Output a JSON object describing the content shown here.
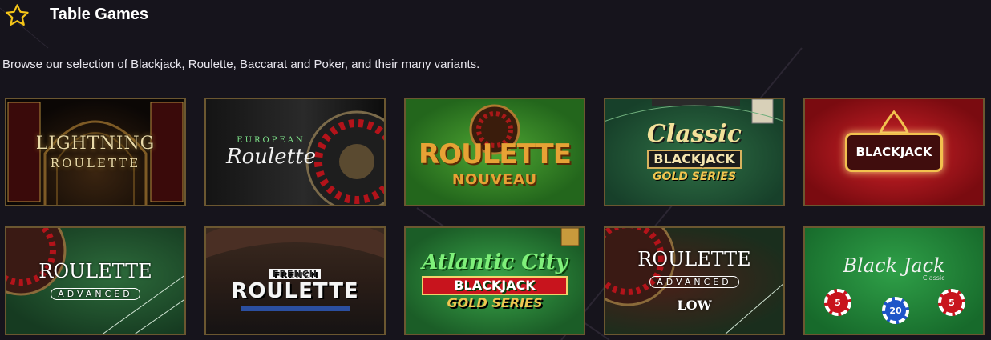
{
  "header": {
    "title": "Table Games",
    "icon": "star-icon",
    "accent": "#f5c518"
  },
  "description": "Browse our selection of Blackjack, Roulette, Baccarat and Poker, and their many variants.",
  "games": [
    {
      "main": "LIGHTNING",
      "sub": "ROULETTE"
    },
    {
      "top": "EUROPEAN",
      "main": "Roulette"
    },
    {
      "main": "ROULETTE",
      "sub": "NOUVEAU"
    },
    {
      "main": "Classic",
      "sub": "BLACKJACK",
      "sub2": "GOLD SERIES"
    },
    {
      "main": "BLACKJACK"
    },
    {
      "main": "ROULETTE",
      "sub": "ADVANCED"
    },
    {
      "top": "FRENCH",
      "main": "ROULETTE"
    },
    {
      "main": "Atlantic City",
      "sub": "BLACKJACK",
      "sub2": "GOLD SERIES"
    },
    {
      "main": "ROULETTE",
      "sub": "ADVANCED",
      "extra": "LOW"
    },
    {
      "main": "Black Jack",
      "sub": "Classic",
      "chips": [
        "5",
        "20",
        "5"
      ]
    }
  ]
}
